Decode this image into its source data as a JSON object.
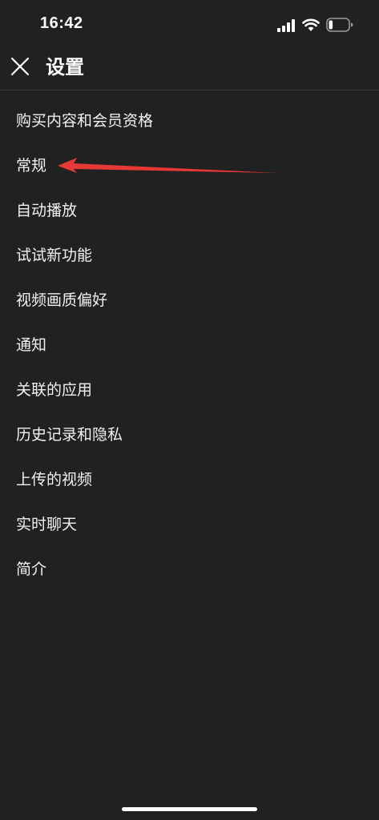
{
  "status_bar": {
    "time": "16:42",
    "signal_icon": "cellular-signal-icon",
    "wifi_icon": "wifi-icon",
    "battery_icon": "battery-low-icon",
    "battery_level_fraction": 0.2
  },
  "header": {
    "close_icon": "close-icon",
    "title": "设置"
  },
  "menu": {
    "items": [
      {
        "label": "购买内容和会员资格"
      },
      {
        "label": "常规"
      },
      {
        "label": "自动播放"
      },
      {
        "label": "试试新功能"
      },
      {
        "label": "视频画质偏好"
      },
      {
        "label": "通知"
      },
      {
        "label": "关联的应用"
      },
      {
        "label": "历史记录和隐私"
      },
      {
        "label": "上传的视频"
      },
      {
        "label": "实时聊天"
      },
      {
        "label": "简介"
      }
    ]
  },
  "annotation": {
    "arrow_color": "#e53935",
    "points_to": "常规"
  },
  "colors": {
    "background": "#212121",
    "text": "#ffffff",
    "divider": "#3a3a3a"
  }
}
